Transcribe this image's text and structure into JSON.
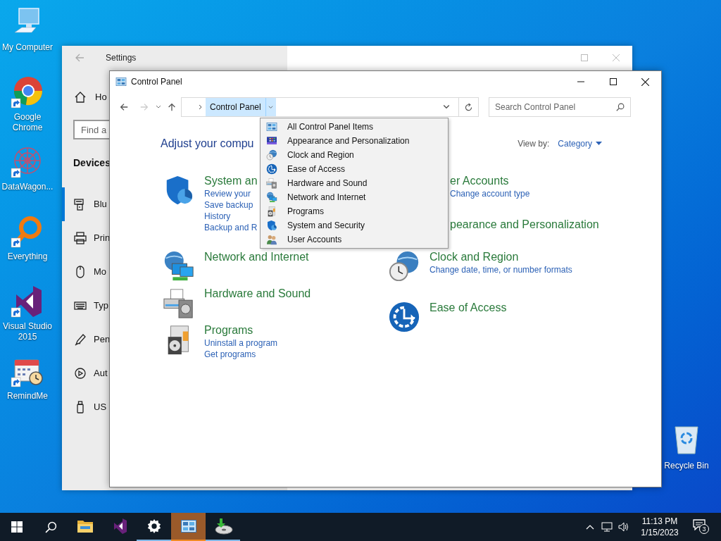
{
  "desktop": {
    "icons": [
      {
        "label": "My Computer",
        "kind": "computer",
        "shortcut": false
      },
      {
        "label": "Google Chrome",
        "kind": "chrome",
        "shortcut": true
      },
      {
        "label": "DataWagon...",
        "kind": "datawagon",
        "shortcut": true
      },
      {
        "label": "Everything",
        "kind": "everything",
        "shortcut": true
      },
      {
        "label": "Visual Studio 2015",
        "kind": "vs",
        "shortcut": true
      },
      {
        "label": "RemindMe",
        "kind": "remindme",
        "shortcut": true
      }
    ],
    "recycle_bin": {
      "label": "Recycle Bin"
    }
  },
  "settings": {
    "title": "Settings",
    "home": "Ho",
    "search": {
      "placeholder": "Find a"
    },
    "section": "Devices",
    "nav": [
      {
        "label": "Blu",
        "kind": "devices",
        "selected": true
      },
      {
        "label": "Prin",
        "kind": "printer",
        "selected": false
      },
      {
        "label": "Mo",
        "kind": "mouse",
        "selected": false
      },
      {
        "label": "Typ",
        "kind": "keyboard",
        "selected": false
      },
      {
        "label": "Pen",
        "kind": "pen",
        "selected": false
      },
      {
        "label": "Aut",
        "kind": "autoplay",
        "selected": false
      },
      {
        "label": "US",
        "kind": "usb",
        "selected": false
      }
    ]
  },
  "control_panel": {
    "title": "Control Panel",
    "nav": {
      "back_enabled": true,
      "forward_enabled": false
    },
    "address": {
      "crumb": "Control Panel"
    },
    "search": {
      "placeholder": "Search Control Panel"
    },
    "heading": "Adjust your compu",
    "view_by": {
      "label": "View by:",
      "value": "Category"
    },
    "columns": [
      [
        {
          "title": "System an",
          "links": [
            "Review your",
            "Save backup",
            "History",
            "Backup and R"
          ],
          "kind": "shield"
        },
        {
          "title": "Network and Internet",
          "kind": "network"
        },
        {
          "title": "Hardware and Sound",
          "kind": "hardware"
        },
        {
          "title": "Programs",
          "links": [
            "Uninstall a program",
            "Get programs"
          ],
          "kind": "programs"
        }
      ],
      [
        {
          "title": "er Accounts",
          "links": [
            "Change account type"
          ],
          "kind": "covered"
        },
        {
          "title": "pearance and Personalization",
          "kind": "covered"
        },
        {
          "title": "Clock and Region",
          "links": [
            "Change date, time, or number formats"
          ],
          "kind": "clock"
        },
        {
          "title": "Ease of Access",
          "kind": "ease"
        }
      ]
    ],
    "dropdown": [
      {
        "label": "All Control Panel Items",
        "kind": "cp"
      },
      {
        "label": "Appearance and Personalization",
        "kind": "appearance"
      },
      {
        "label": "Clock and Region",
        "kind": "clock"
      },
      {
        "label": "Ease of Access",
        "kind": "ease"
      },
      {
        "label": "Hardware and Sound",
        "kind": "hardware"
      },
      {
        "label": "Network and Internet",
        "kind": "network"
      },
      {
        "label": "Programs",
        "kind": "programs"
      },
      {
        "label": "System and Security",
        "kind": "shield"
      },
      {
        "label": "User Accounts",
        "kind": "users"
      }
    ]
  },
  "taskbar": {
    "apps": [
      {
        "kind": "explorer",
        "selected": false,
        "running": false
      },
      {
        "kind": "vs",
        "selected": false,
        "running": false
      },
      {
        "kind": "settings",
        "selected": false,
        "running": true
      },
      {
        "kind": "controlpanel",
        "selected": true,
        "running": true
      },
      {
        "kind": "installer",
        "selected": false,
        "running": true
      }
    ],
    "tray": {
      "time": "11:13 PM",
      "date": "1/15/2023",
      "notifications": "3"
    }
  }
}
